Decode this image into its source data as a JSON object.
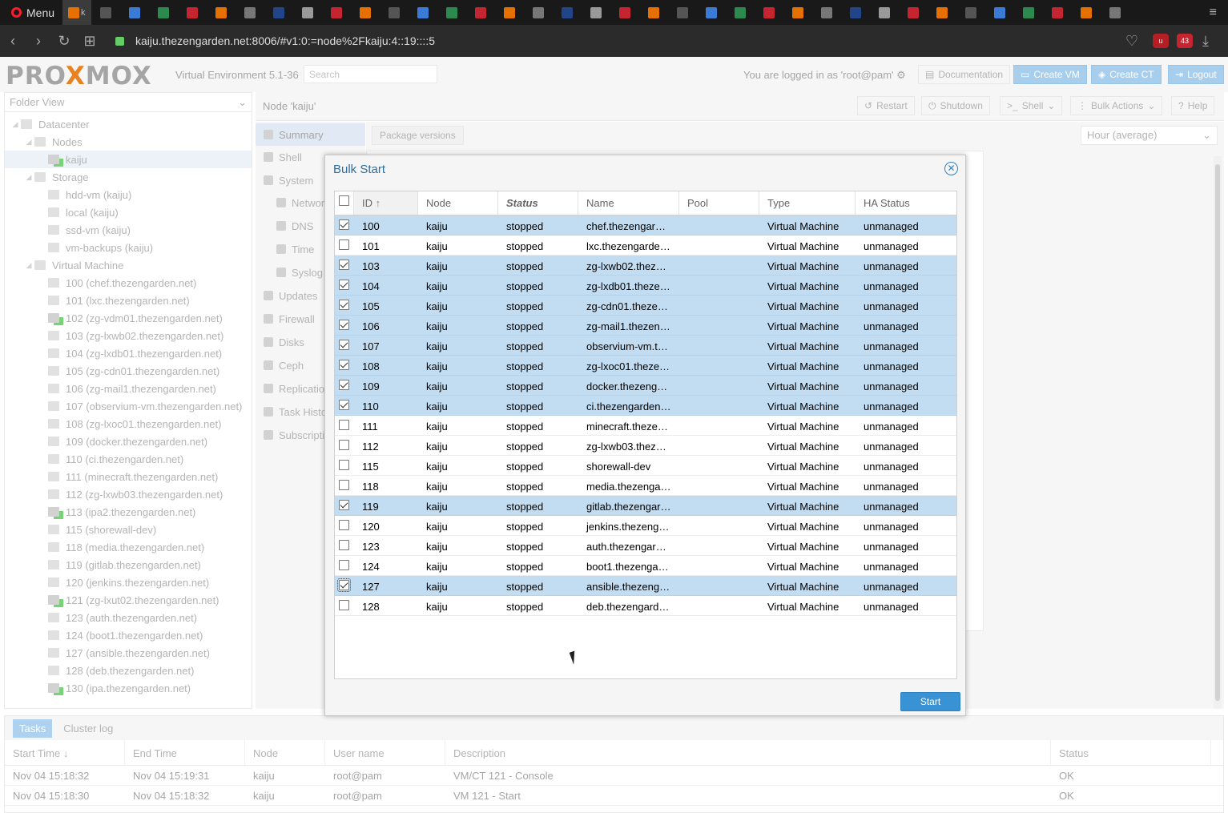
{
  "browser": {
    "menu_label": "Menu",
    "active_tab_label": "ka",
    "url": "kaiju.thezengarden.net:8006/#v1:0:=node%2Fkaiju:4::19::::5",
    "ext_badge": "43"
  },
  "header": {
    "logo_pre": "PRO",
    "logo_x": "X",
    "logo_post": "MOX",
    "version": "Virtual Environment 5.1-36",
    "search_placeholder": "Search",
    "logged_in": "You are logged in as 'root@pam'",
    "doc_label": "Documentation",
    "create_vm_label": "Create VM",
    "create_ct_label": "Create CT",
    "logout_label": "Logout"
  },
  "left": {
    "folder_view": "Folder View",
    "tree": [
      {
        "label": "Datacenter",
        "level": 0,
        "type": "dc"
      },
      {
        "label": "Nodes",
        "level": 1,
        "type": "folder"
      },
      {
        "label": "kaiju",
        "level": 2,
        "type": "node",
        "selected": true
      },
      {
        "label": "Storage",
        "level": 1,
        "type": "folder"
      },
      {
        "label": "hdd-vm (kaiju)",
        "level": 2,
        "type": "storage"
      },
      {
        "label": "local (kaiju)",
        "level": 2,
        "type": "storage"
      },
      {
        "label": "ssd-vm (kaiju)",
        "level": 2,
        "type": "storage"
      },
      {
        "label": "vm-backups (kaiju)",
        "level": 2,
        "type": "storage"
      },
      {
        "label": "Virtual Machine",
        "level": 1,
        "type": "folder"
      },
      {
        "label": "100 (chef.thezengarden.net)",
        "level": 2,
        "type": "vm"
      },
      {
        "label": "101 (lxc.thezengarden.net)",
        "level": 2,
        "type": "vm"
      },
      {
        "label": "102 (zg-vdm01.thezengarden.net)",
        "level": 2,
        "type": "vm-running"
      },
      {
        "label": "103 (zg-lxwb02.thezengarden.net)",
        "level": 2,
        "type": "vm"
      },
      {
        "label": "104 (zg-lxdb01.thezengarden.net)",
        "level": 2,
        "type": "vm"
      },
      {
        "label": "105 (zg-cdn01.thezengarden.net)",
        "level": 2,
        "type": "vm"
      },
      {
        "label": "106 (zg-mail1.thezengarden.net)",
        "level": 2,
        "type": "vm"
      },
      {
        "label": "107 (observium-vm.thezengarden.net)",
        "level": 2,
        "type": "vm"
      },
      {
        "label": "108 (zg-lxoc01.thezengarden.net)",
        "level": 2,
        "type": "vm"
      },
      {
        "label": "109 (docker.thezengarden.net)",
        "level": 2,
        "type": "vm"
      },
      {
        "label": "110 (ci.thezengarden.net)",
        "level": 2,
        "type": "vm"
      },
      {
        "label": "111 (minecraft.thezengarden.net)",
        "level": 2,
        "type": "vm"
      },
      {
        "label": "112 (zg-lxwb03.thezengarden.net)",
        "level": 2,
        "type": "vm"
      },
      {
        "label": "113 (ipa2.thezengarden.net)",
        "level": 2,
        "type": "vm-running"
      },
      {
        "label": "115 (shorewall-dev)",
        "level": 2,
        "type": "vm"
      },
      {
        "label": "118 (media.thezengarden.net)",
        "level": 2,
        "type": "vm"
      },
      {
        "label": "119 (gitlab.thezengarden.net)",
        "level": 2,
        "type": "vm"
      },
      {
        "label": "120 (jenkins.thezengarden.net)",
        "level": 2,
        "type": "vm"
      },
      {
        "label": "121 (zg-lxut02.thezengarden.net)",
        "level": 2,
        "type": "vm-running"
      },
      {
        "label": "123 (auth.thezengarden.net)",
        "level": 2,
        "type": "vm"
      },
      {
        "label": "124 (boot1.thezengarden.net)",
        "level": 2,
        "type": "vm"
      },
      {
        "label": "127 (ansible.thezengarden.net)",
        "level": 2,
        "type": "vm"
      },
      {
        "label": "128 (deb.thezengarden.net)",
        "level": 2,
        "type": "vm"
      },
      {
        "label": "130 (ipa.thezengarden.net)",
        "level": 2,
        "type": "vm-running"
      }
    ]
  },
  "node": {
    "title": "Node 'kaiju'",
    "toolbar": [
      "Restart",
      "Shutdown",
      "Shell",
      "Bulk Actions",
      "Help"
    ],
    "nav": [
      "Summary",
      "Shell",
      "System",
      "Network",
      "DNS",
      "Time",
      "Syslog",
      "Updates",
      "Firewall",
      "Disks",
      "Ceph",
      "Replication",
      "Task History",
      "Subscription"
    ],
    "package_versions": "Package versions",
    "timeframe": "Hour (average)"
  },
  "dialog": {
    "title": "Bulk Start",
    "columns": [
      "ID",
      "Node",
      "Status",
      "Name",
      "Pool",
      "Type",
      "HA Status"
    ],
    "rows": [
      {
        "id": "100",
        "node": "kaiju",
        "status": "stopped",
        "name": "chef.thezengar…",
        "pool": "",
        "type": "Virtual Machine",
        "ha": "unmanaged",
        "checked": true
      },
      {
        "id": "101",
        "node": "kaiju",
        "status": "stopped",
        "name": "lxc.thezengarde…",
        "pool": "",
        "type": "Virtual Machine",
        "ha": "unmanaged",
        "checked": false
      },
      {
        "id": "103",
        "node": "kaiju",
        "status": "stopped",
        "name": "zg-lxwb02.thez…",
        "pool": "",
        "type": "Virtual Machine",
        "ha": "unmanaged",
        "checked": true
      },
      {
        "id": "104",
        "node": "kaiju",
        "status": "stopped",
        "name": "zg-lxdb01.theze…",
        "pool": "",
        "type": "Virtual Machine",
        "ha": "unmanaged",
        "checked": true
      },
      {
        "id": "105",
        "node": "kaiju",
        "status": "stopped",
        "name": "zg-cdn01.theze…",
        "pool": "",
        "type": "Virtual Machine",
        "ha": "unmanaged",
        "checked": true
      },
      {
        "id": "106",
        "node": "kaiju",
        "status": "stopped",
        "name": "zg-mail1.thezen…",
        "pool": "",
        "type": "Virtual Machine",
        "ha": "unmanaged",
        "checked": true
      },
      {
        "id": "107",
        "node": "kaiju",
        "status": "stopped",
        "name": "observium-vm.t…",
        "pool": "",
        "type": "Virtual Machine",
        "ha": "unmanaged",
        "checked": true
      },
      {
        "id": "108",
        "node": "kaiju",
        "status": "stopped",
        "name": "zg-lxoc01.theze…",
        "pool": "",
        "type": "Virtual Machine",
        "ha": "unmanaged",
        "checked": true
      },
      {
        "id": "109",
        "node": "kaiju",
        "status": "stopped",
        "name": "docker.thezeng…",
        "pool": "",
        "type": "Virtual Machine",
        "ha": "unmanaged",
        "checked": true
      },
      {
        "id": "110",
        "node": "kaiju",
        "status": "stopped",
        "name": "ci.thezengarden…",
        "pool": "",
        "type": "Virtual Machine",
        "ha": "unmanaged",
        "checked": true
      },
      {
        "id": "111",
        "node": "kaiju",
        "status": "stopped",
        "name": "minecraft.theze…",
        "pool": "",
        "type": "Virtual Machine",
        "ha": "unmanaged",
        "checked": false
      },
      {
        "id": "112",
        "node": "kaiju",
        "status": "stopped",
        "name": "zg-lxwb03.thez…",
        "pool": "",
        "type": "Virtual Machine",
        "ha": "unmanaged",
        "checked": false
      },
      {
        "id": "115",
        "node": "kaiju",
        "status": "stopped",
        "name": "shorewall-dev",
        "pool": "",
        "type": "Virtual Machine",
        "ha": "unmanaged",
        "checked": false
      },
      {
        "id": "118",
        "node": "kaiju",
        "status": "stopped",
        "name": "media.thezenga…",
        "pool": "",
        "type": "Virtual Machine",
        "ha": "unmanaged",
        "checked": false
      },
      {
        "id": "119",
        "node": "kaiju",
        "status": "stopped",
        "name": "gitlab.thezengar…",
        "pool": "",
        "type": "Virtual Machine",
        "ha": "unmanaged",
        "checked": true
      },
      {
        "id": "120",
        "node": "kaiju",
        "status": "stopped",
        "name": "jenkins.thezeng…",
        "pool": "",
        "type": "Virtual Machine",
        "ha": "unmanaged",
        "checked": false
      },
      {
        "id": "123",
        "node": "kaiju",
        "status": "stopped",
        "name": "auth.thezengar…",
        "pool": "",
        "type": "Virtual Machine",
        "ha": "unmanaged",
        "checked": false
      },
      {
        "id": "124",
        "node": "kaiju",
        "status": "stopped",
        "name": "boot1.thezenga…",
        "pool": "",
        "type": "Virtual Machine",
        "ha": "unmanaged",
        "checked": false
      },
      {
        "id": "127",
        "node": "kaiju",
        "status": "stopped",
        "name": "ansible.thezeng…",
        "pool": "",
        "type": "Virtual Machine",
        "ha": "unmanaged",
        "checked": true,
        "focused": true
      },
      {
        "id": "128",
        "node": "kaiju",
        "status": "stopped",
        "name": "deb.thezengard…",
        "pool": "",
        "type": "Virtual Machine",
        "ha": "unmanaged",
        "checked": false
      }
    ],
    "start_label": "Start"
  },
  "tasks": {
    "tabs": [
      "Tasks",
      "Cluster log"
    ],
    "columns": [
      "Start Time",
      "End Time",
      "Node",
      "User name",
      "Description",
      "Status"
    ],
    "rows": [
      [
        "Nov 04 15:18:32",
        "Nov 04 15:19:31",
        "kaiju",
        "root@pam",
        "VM/CT 121 - Console",
        "OK"
      ],
      [
        "Nov 04 15:18:30",
        "Nov 04 15:18:32",
        "kaiju",
        "root@pam",
        "VM 121 - Start",
        "OK"
      ]
    ]
  },
  "colors": {
    "accent": "#3892d4",
    "selected_row": "#c2ddf2",
    "proxmox_orange": "#e57000"
  }
}
